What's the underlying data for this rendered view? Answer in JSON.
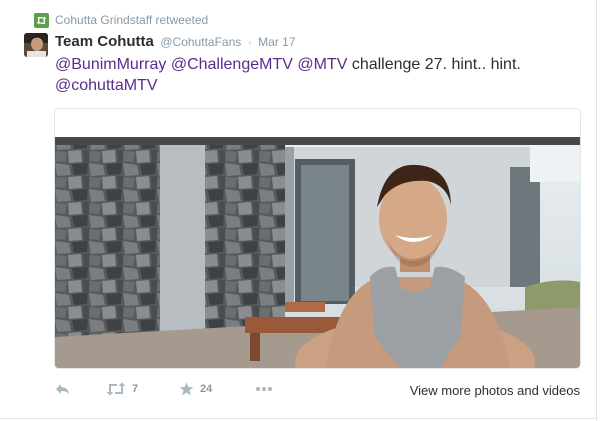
{
  "retweet_context": {
    "text": "Cohutta Grindstaff retweeted",
    "icon": "retweet-icon",
    "icon_color": "#5c9e4a"
  },
  "tweet": {
    "author_name": "Team Cohutta",
    "author_handle": "@CohuttaFans",
    "separator": "·",
    "timestamp": "Mar 17",
    "text_mentions": [
      "@BunimMurray",
      "@ChallengeMTV",
      "@MTV"
    ],
    "text_body": " challenge 27. hint.. hint.",
    "text_mention_end": "@cohuttaMTV",
    "mention_color": "#5b2c8d"
  },
  "actions": {
    "reply_icon": "reply-icon",
    "retweet_icon": "retweet-icon",
    "retweet_count": "7",
    "favorite_icon": "star-icon",
    "favorite_count": "24",
    "more_icon": "more-dots-icon",
    "view_more": "View more photos and videos"
  },
  "colors": {
    "muted": "#8899a6",
    "text": "#292f33",
    "border": "#e1e8ed"
  }
}
